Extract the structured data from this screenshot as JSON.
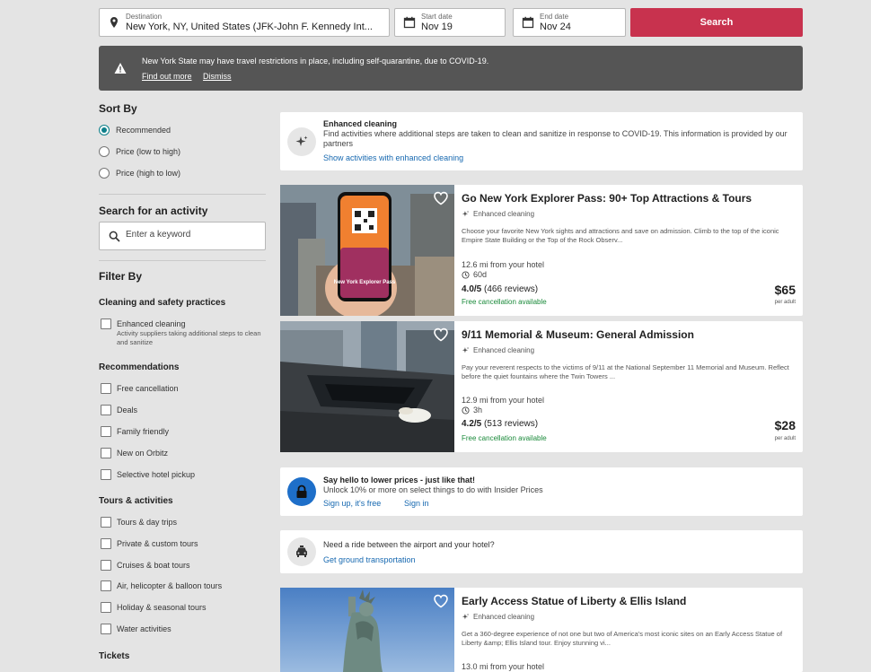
{
  "search": {
    "destination_label": "Destination",
    "destination_value": "New York, NY, United States (JFK-John F. Kennedy Int...",
    "start_label": "Start date",
    "start_value": "Nov 19",
    "end_label": "End date",
    "end_value": "Nov 24",
    "search_button": "Search"
  },
  "banner": {
    "message": "New York State may have travel restrictions in place, including self-quarantine, due to COVID-19.",
    "find_out_more": "Find out more",
    "dismiss": "Dismiss"
  },
  "sidebar": {
    "sort_heading": "Sort By",
    "sort_options": [
      {
        "label": "Recommended",
        "selected": true
      },
      {
        "label": "Price (low to high)",
        "selected": false
      },
      {
        "label": "Price (high to low)",
        "selected": false
      }
    ],
    "search_heading": "Search for an activity",
    "keyword_placeholder": "Enter a keyword",
    "filter_heading": "Filter By",
    "cleaning_heading": "Cleaning and safety practices",
    "cleaning_option": "Enhanced cleaning",
    "cleaning_desc": "Activity suppliers taking additional steps to clean and sanitize",
    "recommendations_heading": "Recommendations",
    "recommendations": [
      "Free cancellation",
      "Deals",
      "Family friendly",
      "New on Orbitz",
      "Selective hotel pickup"
    ],
    "tours_heading": "Tours & activities",
    "tours": [
      "Tours & day trips",
      "Private & custom tours",
      "Cruises & boat tours",
      "Air, helicopter & balloon tours",
      "Holiday & seasonal tours",
      "Water activities"
    ],
    "tickets_heading": "Tickets"
  },
  "enhanced_card": {
    "title": "Enhanced cleaning",
    "text": "Find activities where additional steps are taken to clean and sanitize in response to COVID-19. This information is provided by our partners",
    "link": "Show activities with enhanced cleaning"
  },
  "activities": [
    {
      "title": "Go New York Explorer Pass: 90+ Top Attractions & Tours",
      "badge": "Enhanced cleaning",
      "description": "Choose your favorite New York sights and attractions and save on admission. Climb to the top of the iconic Empire State Building or the Top of the Rock Observ...",
      "distance": "12.6 mi from your hotel",
      "duration": "60d",
      "rating": "4.0/5",
      "reviews": "(466 reviews)",
      "free_cancel": "Free cancellation available",
      "price": "$65",
      "per": "per adult",
      "image_caption": "New York Explorer Pass"
    },
    {
      "title": "9/11 Memorial & Museum: General Admission",
      "badge": "Enhanced cleaning",
      "description": "Pay your reverent respects to the victims of 9/11 at the National September 11 Memorial and Museum. Reflect before the quiet fountains where the Twin Towers ...",
      "distance": "12.9 mi from your hotel",
      "duration": "3h",
      "rating": "4.2/5",
      "reviews": "(513 reviews)",
      "free_cancel": "Free cancellation available",
      "price": "$28",
      "per": "per adult"
    },
    {
      "title": "Early Access Statue of Liberty & Ellis Island",
      "badge": "Enhanced cleaning",
      "description": "Get a 360-degree experience of not one but two of America's most iconic sites on an Early Access Statue of Liberty &amp; Ellis Island tour. Enjoy stunning vi...",
      "distance": "13.0 mi from your hotel"
    }
  ],
  "insider": {
    "title": "Say hello to lower prices - just like that!",
    "text": "Unlock 10% or more on select things to do with Insider Prices",
    "signup": "Sign up, it's free",
    "signin": "Sign in"
  },
  "ground": {
    "text": "Need a ride between the airport and your hotel?",
    "link": "Get ground transportation"
  },
  "colors": {
    "accent": "#c8324e",
    "link": "#1668b0",
    "success": "#1a8a3a",
    "banner": "#555555"
  }
}
